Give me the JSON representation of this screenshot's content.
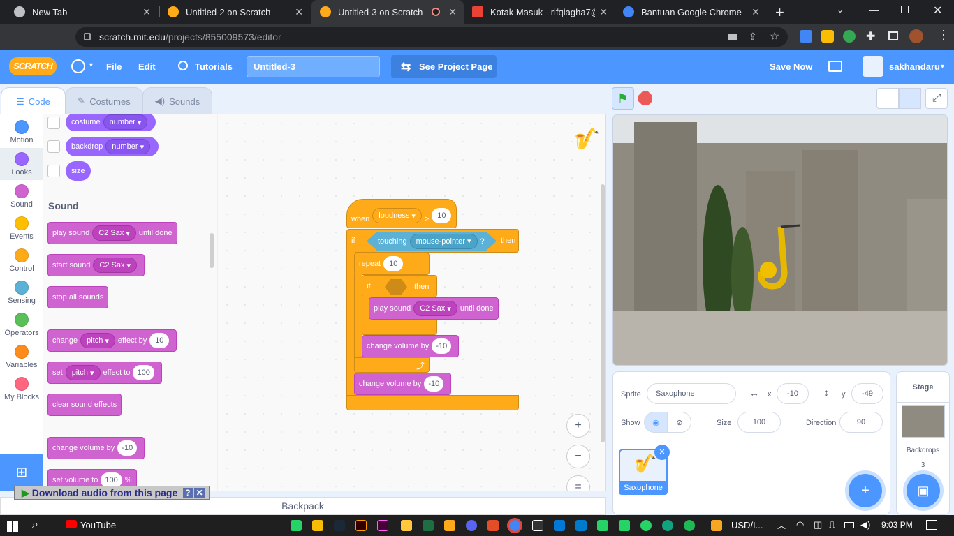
{
  "browser": {
    "tabs": [
      {
        "title": "New Tab"
      },
      {
        "title": "Untitled-2 on Scratch"
      },
      {
        "title": "Untitled-3 on Scratch"
      },
      {
        "title": "Kotak Masuk - rifqiagha7@g"
      },
      {
        "title": "Bantuan Google Chrome"
      }
    ],
    "url_host": "scratch.mit.edu",
    "url_path": "/projects/855009573/editor"
  },
  "menubar": {
    "logo": "SCRATCH",
    "file": "File",
    "edit": "Edit",
    "tutorials": "Tutorials",
    "project_title": "Untitled-3",
    "see_project_page": "See Project Page",
    "save_now": "Save Now",
    "username": "sakhandaru"
  },
  "editor_tabs": {
    "code": "Code",
    "costumes": "Costumes",
    "sounds": "Sounds"
  },
  "categories": [
    {
      "label": "Motion",
      "color": "#4c97ff"
    },
    {
      "label": "Looks",
      "color": "#9966ff"
    },
    {
      "label": "Sound",
      "color": "#cf63cf"
    },
    {
      "label": "Events",
      "color": "#ffbf00"
    },
    {
      "label": "Control",
      "color": "#ffab19"
    },
    {
      "label": "Sensing",
      "color": "#5cb1d6"
    },
    {
      "label": "Operators",
      "color": "#59c059"
    },
    {
      "label": "Variables",
      "color": "#ff8c1a"
    },
    {
      "label": "My Blocks",
      "color": "#ff6680"
    }
  ],
  "palette": {
    "looks_reporters": {
      "costume": "costume",
      "costume_opt": "number",
      "backdrop": "backdrop",
      "backdrop_opt": "number",
      "size": "size"
    },
    "sound_heading": "Sound",
    "play_sound": {
      "a": "play sound",
      "sound": "C2 Sax",
      "b": "until done"
    },
    "start_sound": {
      "a": "start sound",
      "sound": "C2 Sax"
    },
    "stop_all": "stop all sounds",
    "change_effect": {
      "a": "change",
      "effect": "pitch",
      "b": "effect by",
      "val": "10"
    },
    "set_effect": {
      "a": "set",
      "effect": "pitch",
      "b": "effect to",
      "val": "100"
    },
    "clear_effects": "clear sound effects",
    "change_volume": {
      "a": "change volume by",
      "val": "-10"
    },
    "set_volume": {
      "a": "set volume to",
      "val": "100",
      "unit": "%"
    }
  },
  "script": {
    "hat": {
      "a": "when",
      "opt": "loudness",
      "op": ">",
      "val": "10"
    },
    "if1": {
      "a": "if",
      "touching": "touching",
      "target": "mouse-pointer",
      "q": "?",
      "then": "then"
    },
    "repeat": {
      "a": "repeat",
      "val": "10"
    },
    "if2": {
      "a": "if",
      "then": "then"
    },
    "play_sound": {
      "a": "play sound",
      "sound": "C2 Sax",
      "b": "until done"
    },
    "change_vol_inner": {
      "a": "change volume by",
      "val": "-10"
    },
    "change_vol_outer": {
      "a": "change volume by",
      "val": "-10"
    }
  },
  "zoom": {
    "in": "+",
    "out": "−",
    "reset": "="
  },
  "backpack": "Backpack",
  "download_bar": "Download audio from this page",
  "sprite_info": {
    "sprite_label": "Sprite",
    "sprite_name": "Saxophone",
    "x_label": "x",
    "x": "-10",
    "y_label": "y",
    "y": "-49",
    "show_label": "Show",
    "size_label": "Size",
    "size": "100",
    "direction_label": "Direction",
    "direction": "90"
  },
  "sprite_list": [
    {
      "name": "Saxophone"
    }
  ],
  "stage_panel": {
    "label": "Stage",
    "backdrops_label": "Backdrops",
    "backdrops_count": "3"
  },
  "taskbar": {
    "youtube": "YouTube",
    "currency": "USD/I...",
    "time": "9:03 PM"
  }
}
